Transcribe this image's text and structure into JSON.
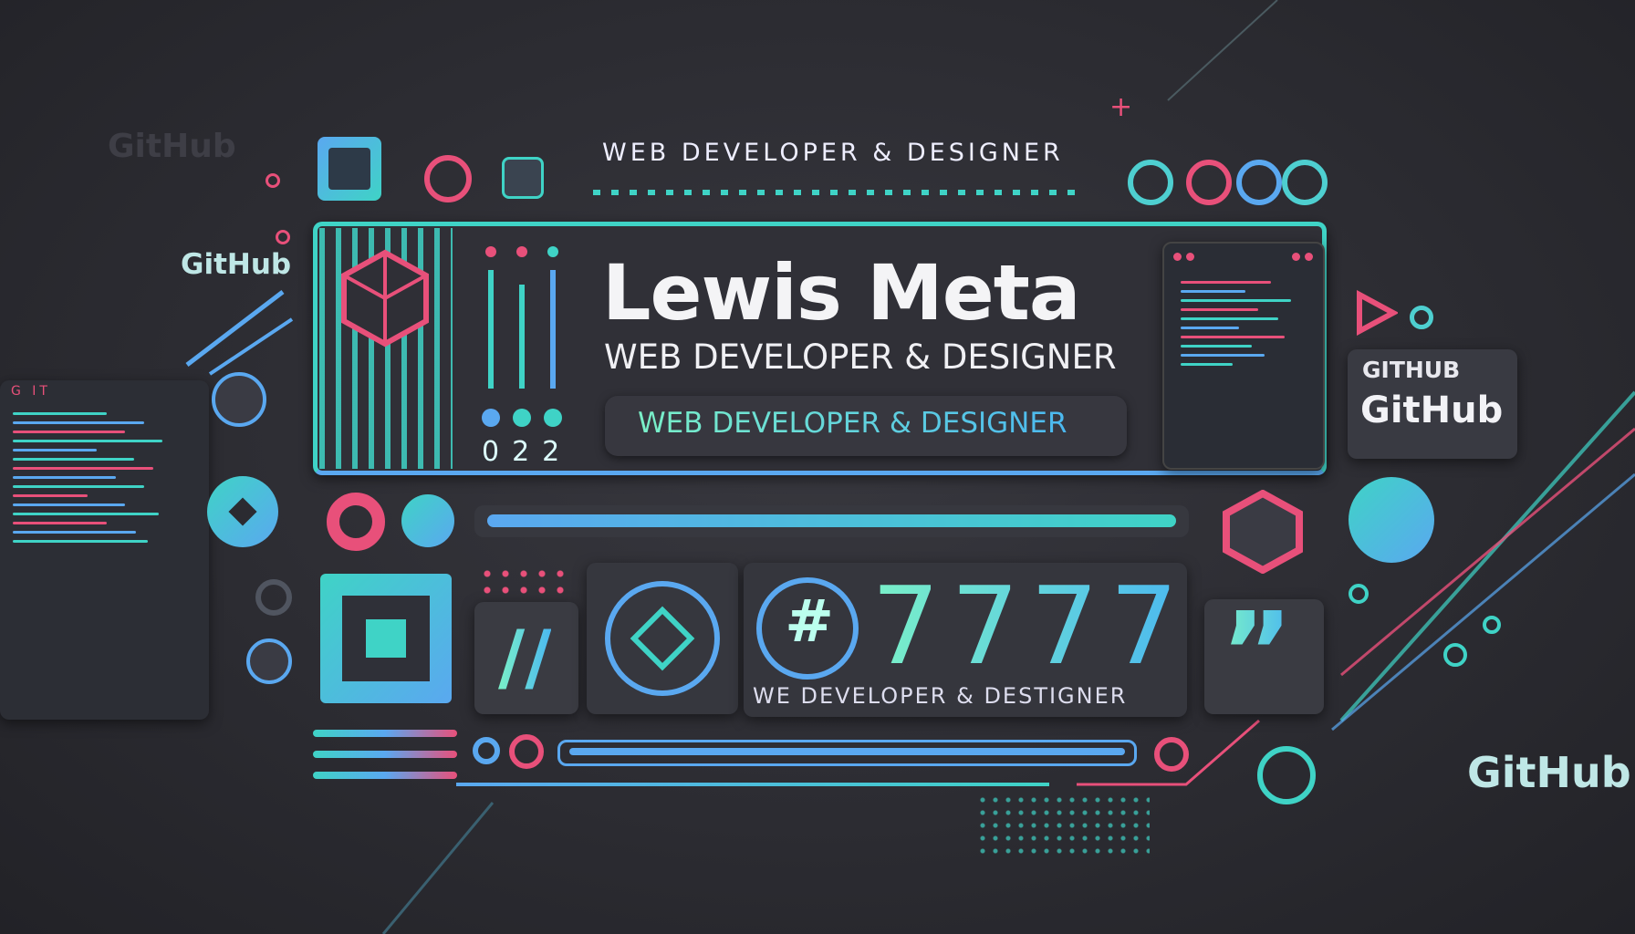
{
  "header": {
    "tagline": "WEB DEVELOPER & DESIGNER"
  },
  "hero": {
    "name": "Lewis Meta",
    "subtitle": "WEB DEVELOPER & DESIGNER",
    "pill_label": "WEB DEVELOPER & DESIGNER"
  },
  "sliders": {
    "digits": "022"
  },
  "stats": {
    "hash_symbol": "#",
    "number": "7777",
    "caption": "WE DEVELOPER & DESTIGNER"
  },
  "github": {
    "faded_top_left": "GitHub",
    "left_label": "GitHub",
    "box_upper": "GITHUB",
    "box_lower": "GitHub",
    "bottom_right": "GitHub"
  },
  "code_panel": {
    "title": "G IT"
  },
  "colors": {
    "background": "#2b2b31",
    "teal": "#3fd3c6",
    "blue": "#5aa8f0",
    "pink": "#e8507a",
    "panel": "#303037"
  },
  "icons": [
    "image-icon",
    "record-icon",
    "cloud-icon",
    "hexagon-cube-icon",
    "play-icon",
    "diamond-icon",
    "folder-icon",
    "music-icon",
    "slash-icon",
    "shield-icon",
    "hash-icon",
    "quote-icon",
    "github-icon"
  ]
}
